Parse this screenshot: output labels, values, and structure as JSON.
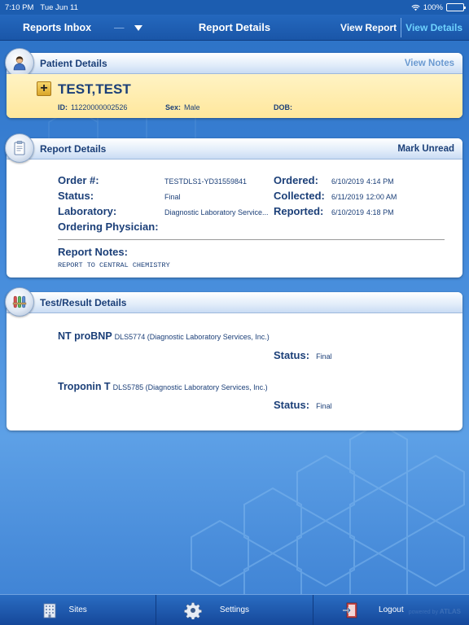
{
  "status_bar": {
    "time": "7:10 PM",
    "date": "Tue Jun 11",
    "battery": "100%"
  },
  "nav": {
    "inbox_label": "Reports Inbox",
    "inbox_dash": "—",
    "title": "Report Details",
    "view_report": "View Report",
    "view_details": "View Details"
  },
  "patient": {
    "header": "Patient Details",
    "action": "View Notes",
    "name": "TEST,TEST",
    "id_label": "ID:",
    "id_value": "11220000002526",
    "sex_label": "Sex:",
    "sex_value": "Male",
    "dob_label": "DOB:",
    "dob_value": ""
  },
  "report": {
    "header": "Report Details",
    "action": "Mark Unread",
    "order_label": "Order #:",
    "order_value": "TESTDLS1-YD31559841",
    "status_label": "Status:",
    "status_value": "Final",
    "lab_label": "Laboratory:",
    "lab_value": "Diagnostic Laboratory Service...",
    "physician_label": "Ordering Physician:",
    "ordered_label": "Ordered:",
    "ordered_date": "6/10/2019",
    "ordered_time": "4:14 PM",
    "collected_label": "Collected:",
    "collected_date": "6/11/2019",
    "collected_time": "12:00 AM",
    "reported_label": "Reported:",
    "reported_date": "6/10/2019",
    "reported_time": "4:18 PM",
    "notes_label": "Report Notes:",
    "notes_value": "REPORT TO CENTRAL CHEMISTRY"
  },
  "tests": {
    "header": "Test/Result Details",
    "items": [
      {
        "name": "NT proBNP",
        "detail": "DLS5774 (Diagnostic Laboratory Services, Inc.)",
        "status_label": "Status:",
        "status_value": "Final"
      },
      {
        "name": "Troponin T",
        "detail": "DLS5785 (Diagnostic Laboratory Services, Inc.)",
        "status_label": "Status:",
        "status_value": "Final"
      }
    ]
  },
  "toolbar": {
    "sites": "Sites",
    "settings": "Settings",
    "logout": "Logout",
    "brand_prefix": "powered by",
    "brand": "ATLAS"
  },
  "colors": {
    "nav_bg": "#1a56a8",
    "accent_link": "#6fd3ff",
    "panel_title": "#1b3f78",
    "view_notes": "#6b9ad1",
    "mark_unread": "#1b3f78",
    "patient_bg": "#ffe79c"
  }
}
